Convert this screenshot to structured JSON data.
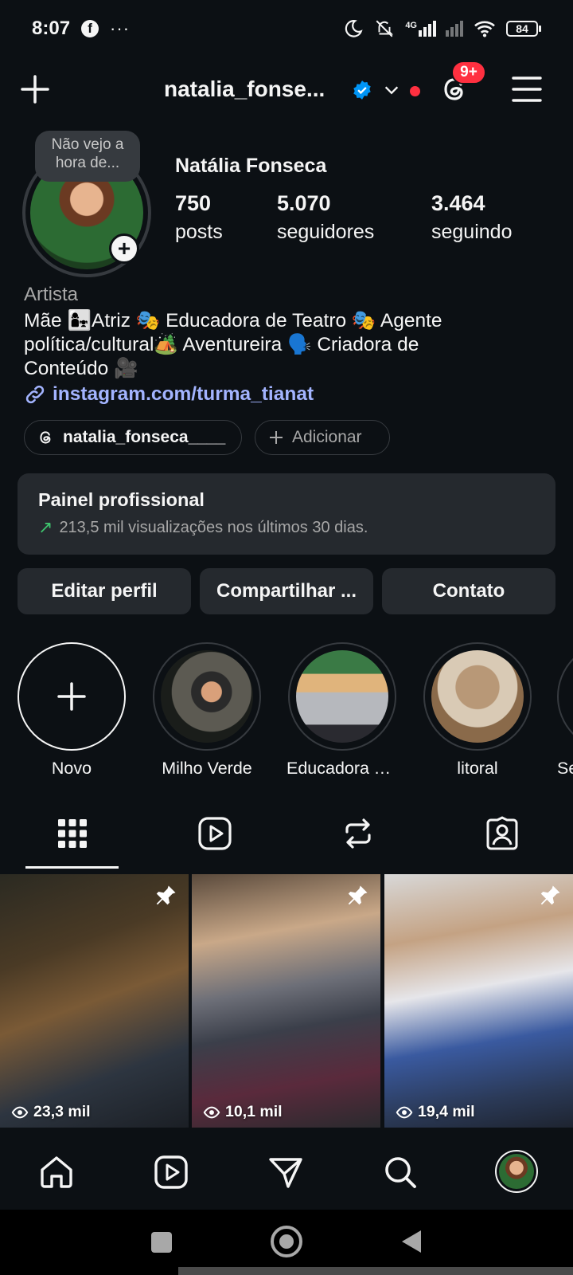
{
  "status_bar": {
    "time": "8:07",
    "fb_icon": "f",
    "more": "···",
    "network": "4G",
    "battery": "84"
  },
  "header": {
    "username": "natalia_fonse...",
    "notifications_badge": "9+"
  },
  "profile": {
    "note": "Não vejo a hora de...",
    "display_name": "Natália Fonseca",
    "stats": [
      {
        "value": "750",
        "label": "posts"
      },
      {
        "value": "5.070",
        "label": "seguidores"
      },
      {
        "value": "3.464",
        "label": "seguindo"
      }
    ],
    "category": "Artista",
    "bio_lines": [
      "Mãe 👩‍👧Atriz 🎭 Educadora de Teatro 🎭 Agente",
      "política/cultural🏕️ Aventureira 🗣️ Criadora de",
      "Conteúdo 🎥"
    ],
    "link": "instagram.com/turma_tianat"
  },
  "pills": {
    "threads_handle": "natalia_fonseca____",
    "add_label": "Adicionar"
  },
  "panel": {
    "title": "Painel profissional",
    "subtitle": "213,5 mil visualizações nos últimos 30 dias."
  },
  "actions": {
    "edit": "Editar perfil",
    "share": "Compartilhar ...",
    "contact": "Contato"
  },
  "highlights": [
    "Novo",
    "Milho Verde",
    "Educadora Te...",
    "litoral",
    "Se"
  ],
  "grid": [
    {
      "views": "23,3 mil"
    },
    {
      "views": "10,1 mil"
    },
    {
      "views": "19,4 mil"
    }
  ],
  "colors": {
    "background": "#0c1014",
    "link": "#a3b4ff",
    "badge": "#ff3040",
    "verified": "#0095f6",
    "surface": "#25292e"
  }
}
